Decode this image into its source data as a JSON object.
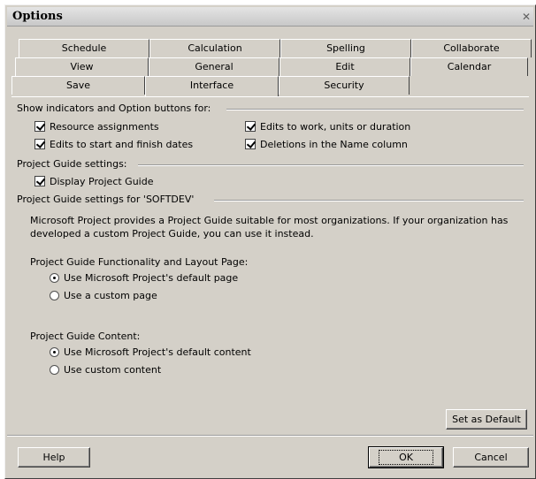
{
  "window": {
    "title": "Options"
  },
  "tabs": {
    "row1": [
      "Schedule",
      "Calculation",
      "Spelling",
      "Collaborate"
    ],
    "row2": [
      "View",
      "General",
      "Edit",
      "Calendar"
    ],
    "row3": [
      "Save",
      "Interface",
      "Security"
    ],
    "active": "Interface"
  },
  "indicators": {
    "heading": "Show indicators and Option buttons for:",
    "resource_assignments": {
      "label": "Resource assignments",
      "checked": true
    },
    "edits_start_finish": {
      "label": "Edits to start and finish dates",
      "checked": true
    },
    "edits_work_units": {
      "label": "Edits to work, units or duration",
      "checked": true
    },
    "deletions_name": {
      "label": "Deletions in the Name column",
      "checked": true
    }
  },
  "project_guide": {
    "heading": "Project Guide settings:",
    "display": {
      "label": "Display Project Guide",
      "checked": true
    }
  },
  "guide_for": {
    "heading": "Project Guide settings for 'SOFTDEV'",
    "description": "Microsoft Project provides a Project Guide suitable for most organizations. If your organization has developed a custom Project Guide, you can use it instead.",
    "functionality_label": "Project Guide Functionality and Layout Page:",
    "functionality_options": [
      {
        "label": "Use Microsoft Project's default page",
        "selected": true
      },
      {
        "label": "Use a custom page",
        "selected": false
      }
    ],
    "content_label": "Project Guide Content:",
    "content_options": [
      {
        "label": "Use Microsoft Project's default content",
        "selected": true
      },
      {
        "label": "Use custom content",
        "selected": false
      }
    ]
  },
  "buttons": {
    "set_default": "Set as Default",
    "help": "Help",
    "ok": "OK",
    "cancel": "Cancel"
  },
  "icons": {
    "close": "close-icon"
  }
}
